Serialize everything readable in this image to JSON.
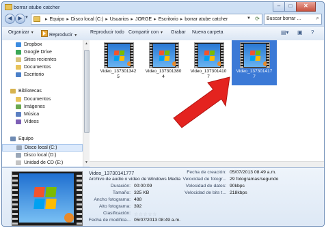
{
  "window": {
    "title": "borrar atube catcher"
  },
  "address": {
    "crumbs": [
      "Equipo",
      "Disco local (C:)",
      "Usuarios",
      "JORGE",
      "Escritorio",
      "borrar atube catcher"
    ]
  },
  "search": {
    "placeholder": "Buscar borrar ..."
  },
  "toolbar": {
    "organize": "Organizar",
    "play": "Reproducir",
    "play_all": "Reproducir todo",
    "share": "Compartir con",
    "burn": "Grabar",
    "new_folder": "Nueva carpeta"
  },
  "nav": {
    "favorites": [
      "Dropbox",
      "Google Drive",
      "Sitios recientes",
      "Documentos",
      "Escritorio"
    ],
    "libraries_header": "Bibliotecas",
    "libraries": [
      "Documentos",
      "Imágenes",
      "Música",
      "Vídeos"
    ],
    "computer_header": "Equipo",
    "computer": [
      "Disco local (C:)",
      "Disco local (D:)",
      "Unidad de CD (E:)"
    ]
  },
  "files": [
    {
      "line1": "Video_137301342",
      "line2": "5"
    },
    {
      "line1": "Video_137301380",
      "line2": "4"
    },
    {
      "line1": "Video_137301410",
      "line2": "7"
    },
    {
      "line1": "Video_137301417",
      "line2": "7",
      "selected": true
    }
  ],
  "details": {
    "name": "Video_13730141777",
    "type": "Archivo de audio o vídeo de Windows Media",
    "duration_label": "Duración:",
    "duration": "00:00:09",
    "size_label": "Tamaño:",
    "size": "325 KB",
    "width_label": "Ancho fotograma:",
    "width": "488",
    "height_label": "Alto fotograma:",
    "height": "392",
    "rating_label": "Clasificación:",
    "modified_label": "Fecha de modifica...",
    "modified": "05/07/2013 08:49 a.m.",
    "created_label": "Fecha de creación:",
    "created": "05/07/2013 08:49 a.m.",
    "fps_label": "Velocidad de fotogr...",
    "fps": "29 fotogramas/segundo",
    "datarate_label": "Velocidad de datos:",
    "datarate": "90kbps",
    "bitrate_label": "Velocidad de bits t...",
    "bitrate": "218kbps"
  },
  "colors": {
    "selection": "#3b79d6",
    "arrow": "#e4231f",
    "chrome": "#c4d7ef"
  }
}
